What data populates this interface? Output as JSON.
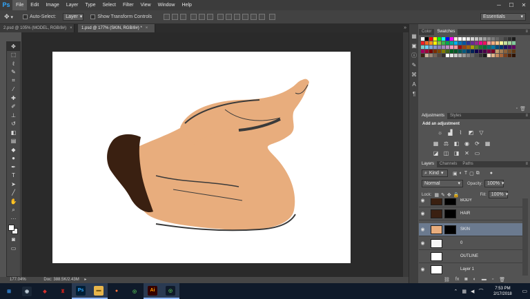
{
  "app": {
    "logo": "Ps"
  },
  "menu": [
    "File",
    "Edit",
    "Image",
    "Layer",
    "Type",
    "Select",
    "Filter",
    "View",
    "Window",
    "Help"
  ],
  "options": {
    "auto_select_label": "Auto-Select:",
    "auto_select_value": "Layer",
    "show_transform_label": "Show Transform Controls",
    "workspace_value": "Essentials"
  },
  "tabs": [
    {
      "label": "2.psd @ 105% (MODEL, RGB/8#)",
      "active": false
    },
    {
      "label": "1.psd @ 177% (SKIN, RGB/8#) *",
      "active": true
    }
  ],
  "status": {
    "zoom": "177.04%",
    "doc": "Doc: 388.5K/2.43M"
  },
  "color_panel": {
    "tabs": [
      "Color",
      "Swatches"
    ],
    "active": 1
  },
  "swatch_colors": [
    "#ffffff",
    "#000000",
    "#ff0000",
    "#ffff00",
    "#00ff00",
    "#00ffff",
    "#0000ff",
    "#ff00ff",
    "#fde6dc",
    "#ffffff",
    "#f7f7f7",
    "#e8e8e8",
    "#d4d4d4",
    "#c4c4c4",
    "#b1b1b1",
    "#9f9f9f",
    "#8c8c8c",
    "#7a7a7a",
    "#676767",
    "#555555",
    "#424242",
    "#2f2f2f",
    "#1c1c1c",
    "#ed1c24",
    "#f26522",
    "#f7941d",
    "#fff200",
    "#8dc63f",
    "#39b54a",
    "#00a651",
    "#00a99d",
    "#00aeef",
    "#0072bc",
    "#0054a6",
    "#2e3192",
    "#662d91",
    "#92278f",
    "#ec008c",
    "#ed145b",
    "#f5989d",
    "#f9ad81",
    "#fdc68a",
    "#fff799",
    "#c4df9b",
    "#a3d39c",
    "#82ca9c",
    "#7accc8",
    "#6dcff6",
    "#7da7d9",
    "#8393ca",
    "#8781bd",
    "#a187be",
    "#bd8cbf",
    "#f49ac2",
    "#f6989d",
    "#9e0b0f",
    "#a0410d",
    "#a36209",
    "#aba000",
    "#598527",
    "#1a7b30",
    "#007236",
    "#00746b",
    "#0076a3",
    "#004a80",
    "#003471",
    "#1b1464",
    "#440e62",
    "#630460",
    "#9e005d",
    "#9e0039",
    "#790000",
    "#7b2e00",
    "#7d4900",
    "#827b00",
    "#406618",
    "#005e20",
    "#005826",
    "#005952",
    "#005b7f",
    "#003663",
    "#002157",
    "#0d004c",
    "#32004b",
    "#4b0049",
    "#7b0046",
    "#7a0026",
    "#c69c6d",
    "#a67c52",
    "#8c6239",
    "#754c24",
    "#603913",
    "#3c2415",
    "#c7b299",
    "#998675",
    "#736357",
    "#534741",
    "#37302f",
    "#ffffff",
    "#e6e6e6",
    "#cccccc",
    "#b3b3b3",
    "#999999",
    "#808080",
    "#666666",
    "#4d4d4d",
    "#333333",
    "#1a1a1a",
    "#f7e1c9",
    "#e0b48b",
    "#c98b5e",
    "#a86539",
    "#7a401d",
    "#4d2209",
    "#2e1200"
  ],
  "adjustments": {
    "tabs": [
      "Adjustments",
      "Styles"
    ],
    "heading": "Add an adjustment"
  },
  "layers_panel": {
    "tabs": [
      "Layers",
      "Channels",
      "Paths"
    ],
    "kind_label": "Kind",
    "blend_mode": "Normal",
    "opacity_label": "Opacity:",
    "opacity_value": "100%",
    "lock_label": "Lock:",
    "fill_label": "Fill:",
    "fill_value": "100%",
    "layers": [
      {
        "name": "BODY",
        "thumb": "#3a2011",
        "mask": true,
        "visible": true,
        "selected": false
      },
      {
        "name": "HAIR",
        "thumb": "#3a2011",
        "mask": true,
        "visible": true,
        "selected": false
      },
      {
        "name": "SKIN",
        "thumb": "#e8ad7d",
        "mask": true,
        "visible": true,
        "selected": true
      },
      {
        "name": "0",
        "thumb": "#f5f5f5",
        "mask": false,
        "visible": true,
        "selected": false
      },
      {
        "name": "OUTLINE",
        "thumb": "#ffffff",
        "mask": false,
        "visible": false,
        "selected": false
      },
      {
        "name": "Layer 1",
        "thumb": "#ffffff",
        "mask": false,
        "visible": true,
        "selected": false
      }
    ]
  },
  "taskbar": {
    "apps": [
      {
        "name": "start",
        "glyph": "⊞",
        "bg": "#0f1a2a",
        "fg": "#3ca0ff"
      },
      {
        "name": "steam",
        "glyph": "◉",
        "bg": "#1b2838",
        "fg": "#c7d5e0"
      },
      {
        "name": "app-red",
        "glyph": "◆",
        "bg": "#0f1a2a",
        "fg": "#d0312d"
      },
      {
        "name": "app-ninja",
        "glyph": "♜",
        "bg": "#0f1a2a",
        "fg": "#c0221b"
      },
      {
        "name": "photoshop",
        "glyph": "Ps",
        "bg": "#001e36",
        "fg": "#31a8ff"
      },
      {
        "name": "file-explorer",
        "glyph": "▬",
        "bg": "#e8b64b",
        "fg": "#7a5a16"
      },
      {
        "name": "firefox",
        "glyph": "●",
        "bg": "#0f1a2a",
        "fg": "#ff7139"
      },
      {
        "name": "chrome",
        "glyph": "◎",
        "bg": "#0f1a2a",
        "fg": "#4caf50"
      },
      {
        "name": "illustrator",
        "glyph": "Ai",
        "bg": "#330000",
        "fg": "#ff9a00"
      },
      {
        "name": "chrome-2",
        "glyph": "◎",
        "bg": "#0f1a2a",
        "fg": "#4caf50"
      }
    ],
    "time": "7:53 PM",
    "date": "2/17/2018"
  },
  "colors": {
    "skin": "#e8ad7d",
    "hair": "#3a2011",
    "outline": "#3a3a3a"
  }
}
